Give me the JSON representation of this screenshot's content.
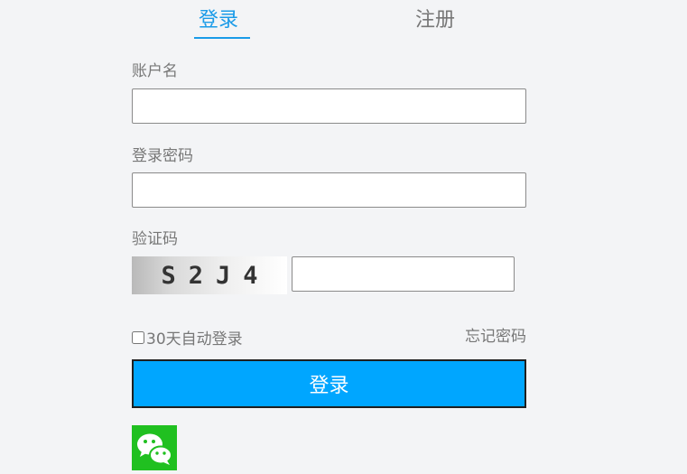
{
  "tabs": {
    "login": "登录",
    "register": "注册"
  },
  "form": {
    "account_label": "账户名",
    "account_value": "",
    "password_label": "登录密码",
    "password_value": "",
    "captcha_label": "验证码",
    "captcha_text": "S2J4",
    "captcha_value": "",
    "remember_label": "30天自动登录",
    "forgot_label": "忘记密码",
    "submit_label": "登录"
  },
  "social": {
    "icon": "wechat-icon",
    "color": "#20c020"
  },
  "colors": {
    "accent": "#1a9be8",
    "button": "#00a6ff"
  }
}
